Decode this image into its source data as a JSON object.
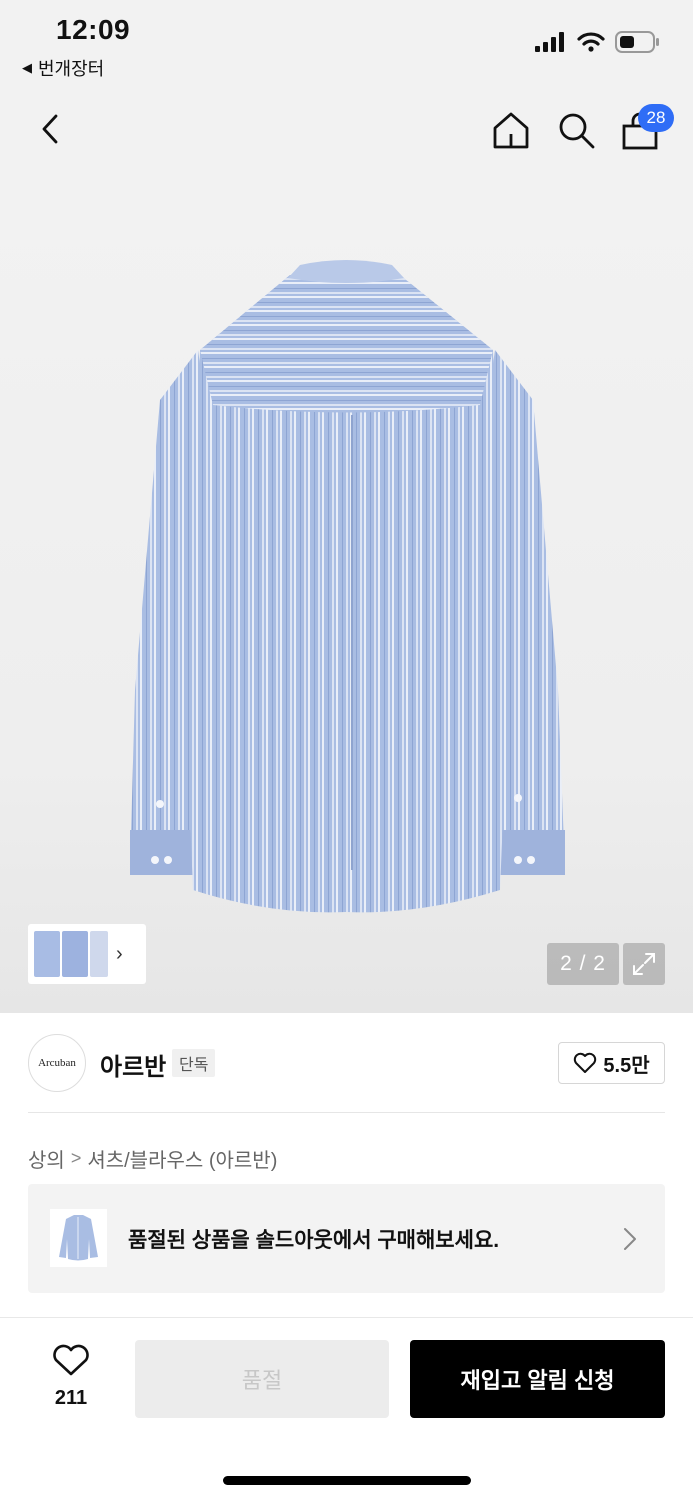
{
  "status_bar": {
    "time": "12:09",
    "back_app_label": "번개장터",
    "icons": [
      "signal-icon",
      "wifi-icon",
      "battery-icon"
    ]
  },
  "nav": {
    "icons": [
      "back-icon",
      "home-icon",
      "search-icon",
      "shopping-bag-icon"
    ],
    "bag_badge_count": "28",
    "badge_color": "#2f6df6"
  },
  "product_image": {
    "pager": "2 / 2",
    "shirt_color": "#a9bde3",
    "stripe_color": "#e9eef8"
  },
  "brand": {
    "logo_text": "Arcuban",
    "name": "아르반",
    "tag": "단독",
    "like_count": "5.5만"
  },
  "breadcrumb": {
    "items": [
      "상의",
      "셔츠/블라우스 (아르반)"
    ]
  },
  "soldout_banner": {
    "text": "품절된 상품을 솔드아웃에서 구매해보세요."
  },
  "bottom_bar": {
    "wish_count": "211",
    "soldout_label": "품절",
    "restock_label": "재입고 알림 신청"
  }
}
